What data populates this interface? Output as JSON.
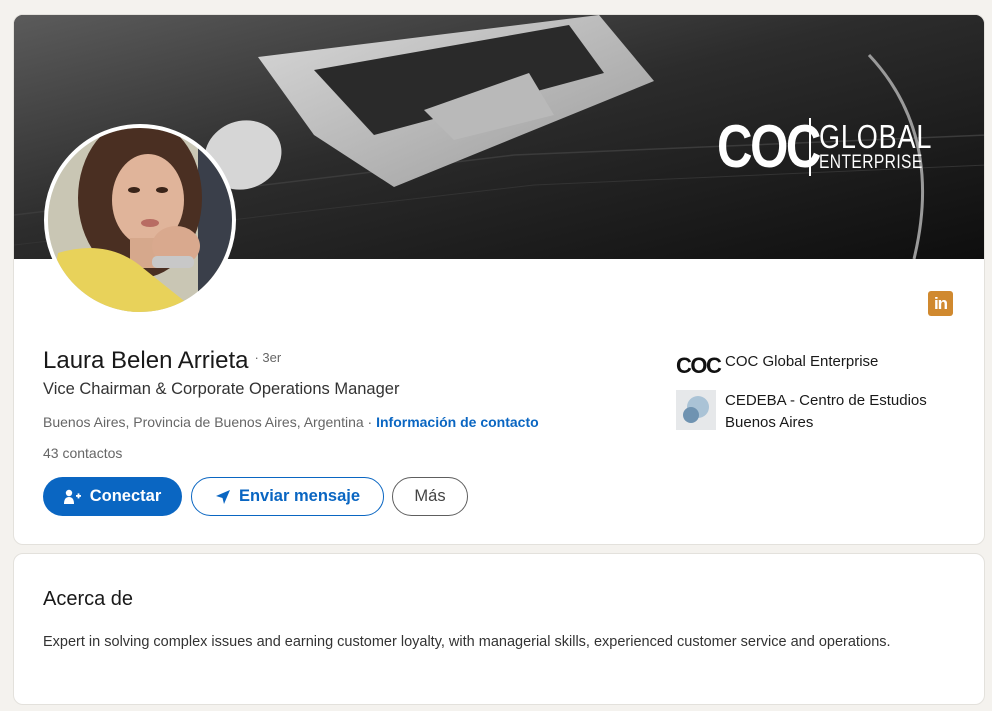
{
  "banner": {
    "brand_main": "COC",
    "brand_line1": "GLOBAL",
    "brand_line2": "ENTERPRISE"
  },
  "profile": {
    "name": "Laura Belen Arrieta",
    "degree": "· 3er",
    "headline": "Vice Chairman & Corporate Operations Manager",
    "location": "Buenos Aires, Provincia de Buenos Aires, Argentina",
    "separator": " · ",
    "contact_link": "Información de contacto",
    "connections": "43 contactos"
  },
  "actions": {
    "connect_label": "Conectar",
    "message_label": "Enviar mensaje",
    "more_label": "Más"
  },
  "orgs": [
    {
      "name": "COC Global Enterprise",
      "logo_text": "COC"
    },
    {
      "name": "CEDEBA - Centro de Estudios Buenos Aires"
    }
  ],
  "linkedin_badge": "in",
  "about": {
    "title": "Acerca de",
    "text": "Expert in solving complex issues and earning customer loyalty, with managerial skills, experienced customer service and operations."
  },
  "colors": {
    "primary": "#0a66c2",
    "linkedin_badge": "#d0892f",
    "page_bg": "#f4f2ee"
  }
}
